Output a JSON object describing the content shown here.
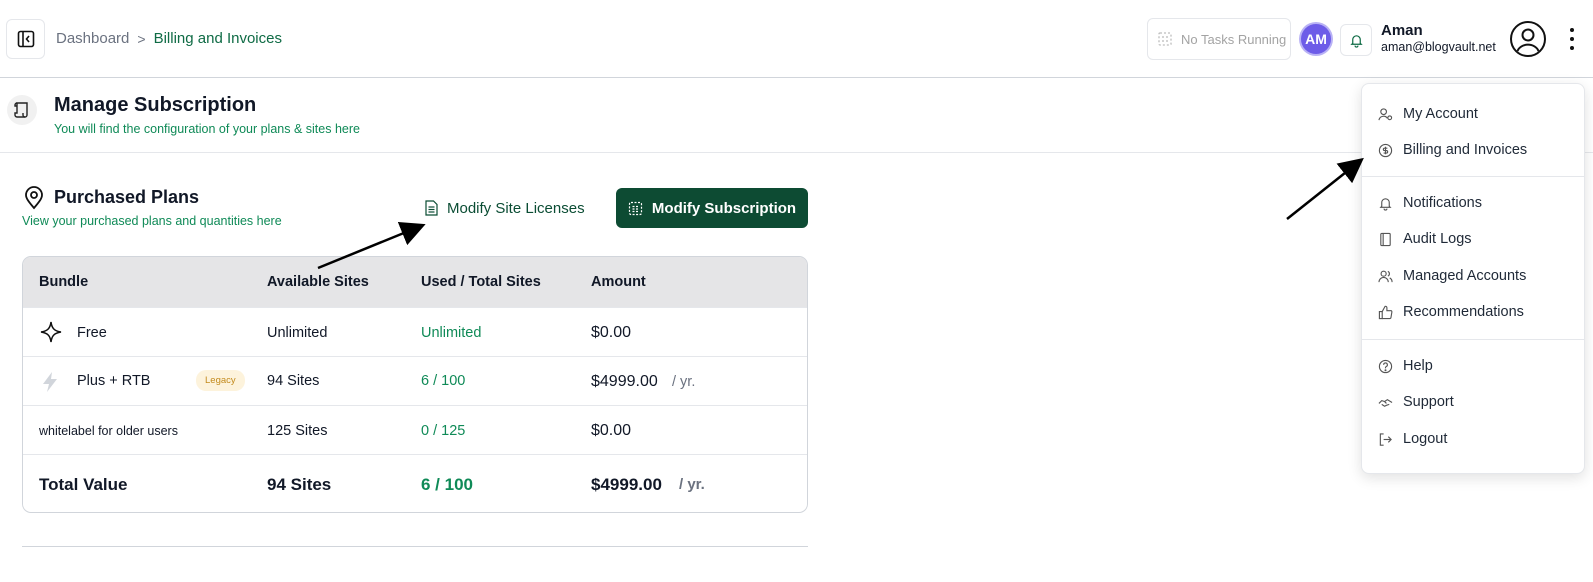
{
  "header": {
    "breadcrumb_root": "Dashboard",
    "breadcrumb_separator": ">",
    "breadcrumb_current": "Billing and Invoices",
    "tasks_status": "No Tasks Running",
    "avatar_initials": "AM",
    "user_name": "Aman",
    "user_email": "aman@blogvault.net"
  },
  "page": {
    "title": "Manage Subscription",
    "subtitle": "You will find the configuration of your plans & sites here"
  },
  "plans": {
    "title": "Purchased Plans",
    "subtitle": "View your purchased plans and quantities here",
    "modify_licenses_label": "Modify Site Licenses",
    "modify_subscription_label": "Modify Subscription",
    "columns": [
      "Bundle",
      "Available Sites",
      "Used / Total Sites",
      "Amount"
    ],
    "rows": [
      {
        "bundle": "Free",
        "icon": "sparkle-icon",
        "available": "Unlimited",
        "used_total": "Unlimited",
        "amount": "$0.00",
        "period": ""
      },
      {
        "bundle": "Plus + RTB",
        "icon": "lightning-icon",
        "badge": "Legacy",
        "available": "94 Sites",
        "used_total": "6 / 100",
        "amount": "$4999.00",
        "period": "/ yr."
      },
      {
        "bundle": "whitelabel for older users",
        "available": "125 Sites",
        "used_total": "0 / 125",
        "amount": "$0.00",
        "period": ""
      }
    ],
    "total": {
      "label": "Total Value",
      "available": "94 Sites",
      "used_total": "6 / 100",
      "amount": "$4999.00",
      "period": "/ yr."
    }
  },
  "menu": {
    "items": [
      {
        "label": "My Account",
        "icon": "user-settings-icon"
      },
      {
        "label": "Billing and Invoices",
        "icon": "dollar-circle-icon"
      },
      {
        "label": "Notifications",
        "icon": "bell-icon"
      },
      {
        "label": "Audit Logs",
        "icon": "notebook-icon"
      },
      {
        "label": "Managed Accounts",
        "icon": "users-icon"
      },
      {
        "label": "Recommendations",
        "icon": "thumbs-up-icon"
      },
      {
        "label": "Help",
        "icon": "help-circle-icon"
      },
      {
        "label": "Support",
        "icon": "handshake-icon"
      },
      {
        "label": "Logout",
        "icon": "logout-icon"
      }
    ]
  },
  "colors": {
    "brand_dark": "#0d4b33",
    "brand_green": "#0f8a57",
    "avatar_purple": "#6d5ce8",
    "legacy_badge_text": "#c38b1e",
    "legacy_badge_bg": "#fdf3dc",
    "table_header_bg": "#e5e5e7"
  }
}
